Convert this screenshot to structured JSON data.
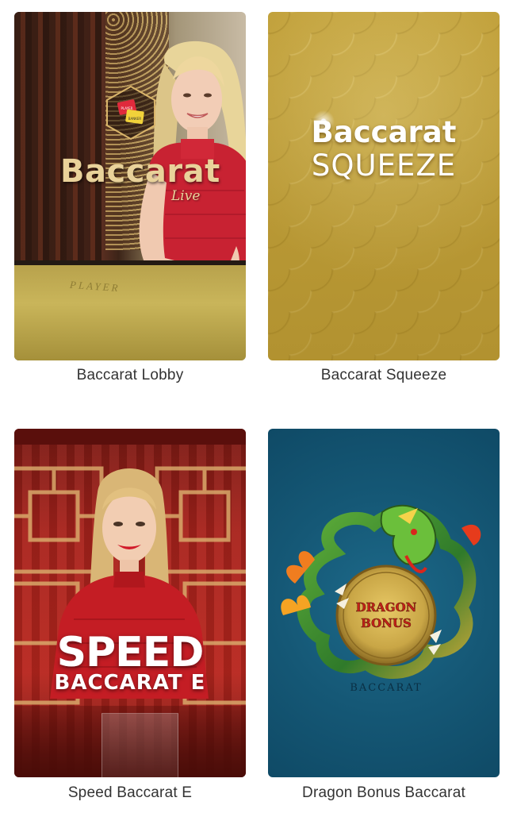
{
  "games": [
    {
      "caption": "Baccarat Lobby",
      "artwork": {
        "title": "Baccarat",
        "subtitle": "Live",
        "logo_text": [
          "PLAYER",
          "BANKER"
        ],
        "table_text": "PLAYER"
      }
    },
    {
      "caption": "Baccarat Squeeze",
      "artwork": {
        "title": "Baccarat",
        "subtitle": "SQUEEZE"
      }
    },
    {
      "caption": "Speed Baccarat E",
      "artwork": {
        "title": "SPEED",
        "subtitle": "BACCARAT E"
      }
    },
    {
      "caption": "Dragon Bonus Baccarat",
      "artwork": {
        "title_line1": "DRAGON",
        "title_line2": "BONUS",
        "ring_text": "BACCARAT"
      }
    }
  ],
  "colors": {
    "caption_text": "#333333",
    "squeeze_gold": "#c1a03a",
    "speed_red": "#b8261e",
    "dragon_blue": "#155876",
    "coin_gold": "#c9a646"
  }
}
